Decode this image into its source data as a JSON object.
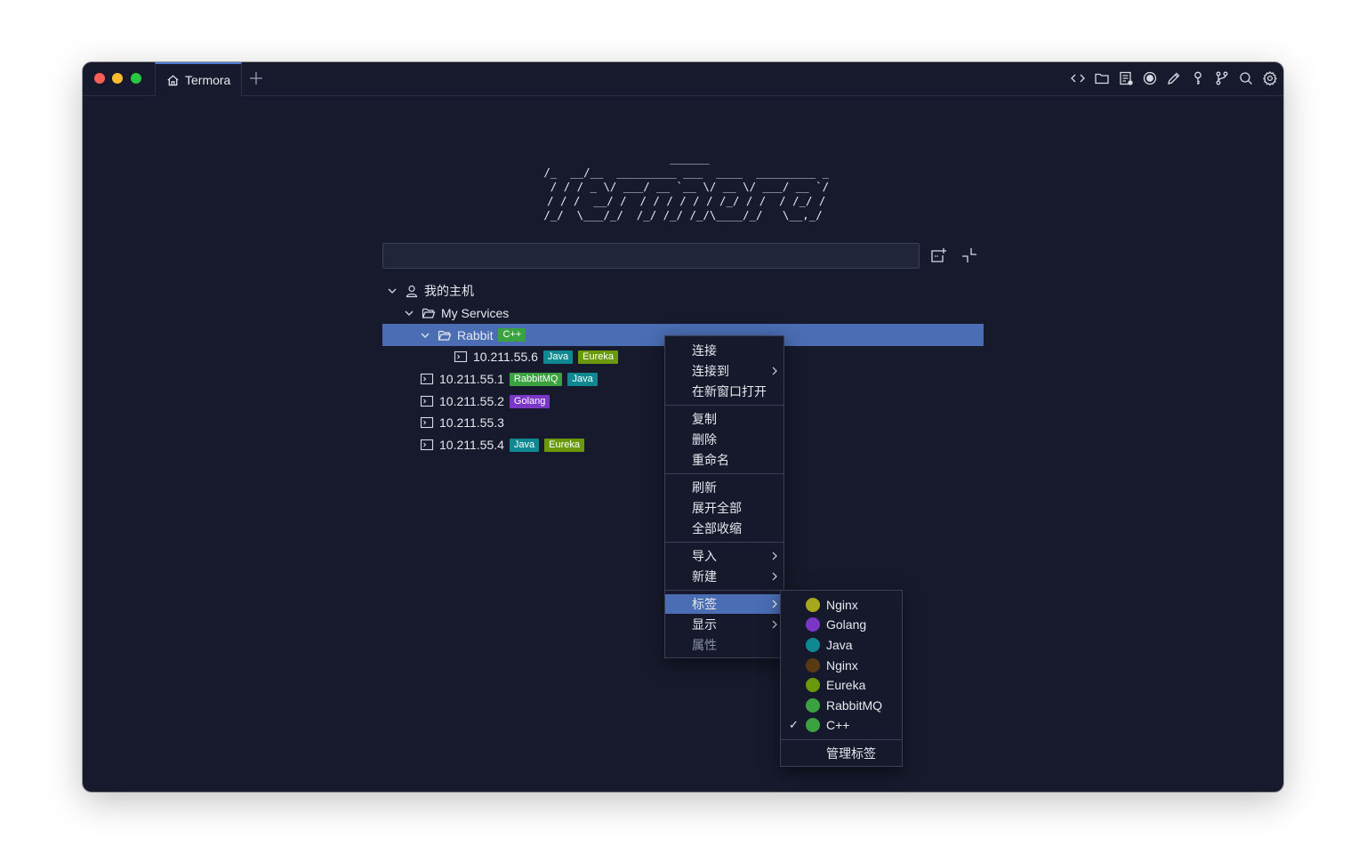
{
  "app": {
    "tab_title": "Termora",
    "banner": "  ______\n /_  __/__  _________ ___  ____  _________ _\n  / / / _ \\/ ___/ __ `__ \\/ __ \\/ ___/ __ `/\n / / /  __/ /  / / / / / / /_/ / /  / /_/ /\n/_/  \\___/_/  /_/ /_/ /_/\\____/_/   \\__,_/"
  },
  "toolbar": {
    "icons": [
      "code-icon",
      "folder-icon",
      "notes-icon",
      "record-icon",
      "pen-icon",
      "key-icon",
      "branch-icon",
      "search-icon",
      "gear-icon"
    ]
  },
  "search": {
    "value": "",
    "placeholder": ""
  },
  "tree": {
    "root": "我的主机",
    "folder": "My Services",
    "subfolder": "Rabbit",
    "subfolder_tag": "C++",
    "hosts": [
      {
        "name": "10.211.55.6",
        "tags": [
          "Java",
          "Eureka"
        ]
      },
      {
        "name": "10.211.55.1",
        "tags": [
          "RabbitMQ",
          "Java"
        ]
      },
      {
        "name": "10.211.55.2",
        "tags": [
          "Golang"
        ]
      },
      {
        "name": "10.211.55.3",
        "tags": []
      },
      {
        "name": "10.211.55.4",
        "tags": [
          "Java",
          "Eureka"
        ]
      }
    ]
  },
  "tag_colors": {
    "C++": "#3aa23e",
    "Java": "#0f8891",
    "Eureka": "#6a9a0c",
    "RabbitMQ": "#3aa23e",
    "Golang": "#7a37c6",
    "Nginx": "#a7a81b",
    "Nginx2": "#5a3a12"
  },
  "context_menu": {
    "items": [
      "连接",
      "连接到",
      "在新窗口打开",
      "复制",
      "删除",
      "重命名",
      "刷新",
      "展开全部",
      "全部收缩",
      "导入",
      "新建",
      "标签",
      "显示",
      "属性"
    ]
  },
  "tag_menu": {
    "items": [
      {
        "label": "Nginx",
        "color": "#a7a81b",
        "checked": false
      },
      {
        "label": "Golang",
        "color": "#7a37c6",
        "checked": false
      },
      {
        "label": "Java",
        "color": "#0f8891",
        "checked": false
      },
      {
        "label": "Nginx",
        "color": "#5a3a12",
        "checked": false
      },
      {
        "label": "Eureka",
        "color": "#6a9a0c",
        "checked": false
      },
      {
        "label": "RabbitMQ",
        "color": "#3aa23e",
        "checked": false
      },
      {
        "label": "C++",
        "color": "#3aa23e",
        "checked": true
      }
    ],
    "manage": "管理标签",
    "check_mark": "✓"
  }
}
